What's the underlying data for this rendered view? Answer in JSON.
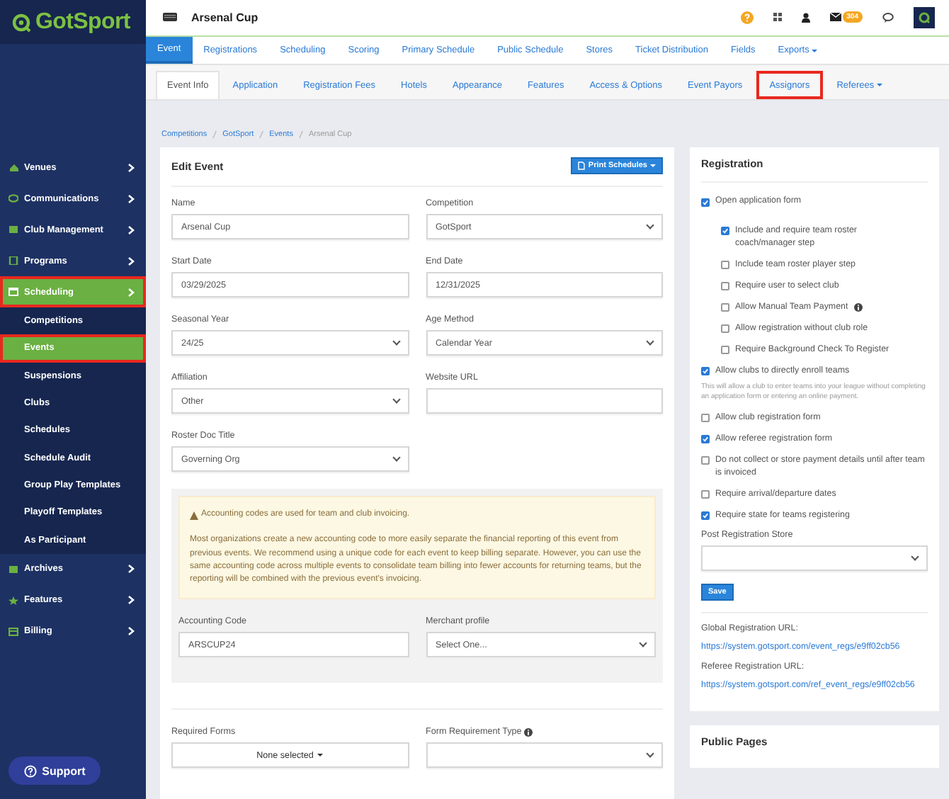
{
  "brand": {
    "name": "GotSport"
  },
  "sidebar": {
    "items": [
      {
        "label": "Venues",
        "selected": false,
        "highlighted": false
      },
      {
        "label": "Communications",
        "selected": false,
        "highlighted": false
      },
      {
        "label": "Club Management",
        "selected": false,
        "highlighted": false
      },
      {
        "label": "Programs",
        "selected": false,
        "highlighted": false
      },
      {
        "label": "Scheduling",
        "selected": true,
        "highlighted": true,
        "children": [
          {
            "label": "Competitions",
            "selected": false,
            "highlighted": false
          },
          {
            "label": "Events",
            "selected": true,
            "highlighted": true
          },
          {
            "label": "Suspensions",
            "selected": false,
            "highlighted": false
          },
          {
            "label": "Clubs",
            "selected": false,
            "highlighted": false
          },
          {
            "label": "Schedules",
            "selected": false,
            "highlighted": false
          },
          {
            "label": "Schedule Audit",
            "selected": false,
            "highlighted": false
          },
          {
            "label": "Group Play Templates",
            "selected": false,
            "highlighted": false
          },
          {
            "label": "Playoff Templates",
            "selected": false,
            "highlighted": false
          },
          {
            "label": "As Participant",
            "selected": false,
            "highlighted": false
          }
        ]
      },
      {
        "label": "Archives",
        "selected": false,
        "highlighted": false
      },
      {
        "label": "Features",
        "selected": false,
        "highlighted": false
      },
      {
        "label": "Billing",
        "selected": false,
        "highlighted": false
      }
    ]
  },
  "support": {
    "label": "Support"
  },
  "header": {
    "title": "Arsenal Cup",
    "badge": "304"
  },
  "nav": {
    "tabs": [
      {
        "label": "Event",
        "selected": true,
        "dropdown": false
      },
      {
        "label": "Registrations",
        "selected": false,
        "dropdown": false
      },
      {
        "label": "Scheduling",
        "selected": false,
        "dropdown": false
      },
      {
        "label": "Scoring",
        "selected": false,
        "dropdown": false
      },
      {
        "label": "Primary Schedule",
        "selected": false,
        "dropdown": false
      },
      {
        "label": "Public Schedule",
        "selected": false,
        "dropdown": false
      },
      {
        "label": "Stores",
        "selected": false,
        "dropdown": false
      },
      {
        "label": "Ticket Distribution",
        "selected": false,
        "dropdown": false
      },
      {
        "label": "Fields",
        "selected": false,
        "dropdown": false
      },
      {
        "label": "Exports",
        "selected": false,
        "dropdown": true
      }
    ]
  },
  "subnav": {
    "tabs": [
      {
        "label": "Event Info",
        "selected": true,
        "highlighted": false,
        "dropdown": false
      },
      {
        "label": "Application",
        "selected": false,
        "highlighted": false,
        "dropdown": false
      },
      {
        "label": "Registration Fees",
        "selected": false,
        "highlighted": false,
        "dropdown": false
      },
      {
        "label": "Hotels",
        "selected": false,
        "highlighted": false,
        "dropdown": false
      },
      {
        "label": "Appearance",
        "selected": false,
        "highlighted": false,
        "dropdown": false
      },
      {
        "label": "Features",
        "selected": false,
        "highlighted": false,
        "dropdown": false
      },
      {
        "label": "Access & Options",
        "selected": false,
        "highlighted": false,
        "dropdown": false
      },
      {
        "label": "Event Payors",
        "selected": false,
        "highlighted": false,
        "dropdown": false
      },
      {
        "label": "Assignors",
        "selected": false,
        "highlighted": true,
        "dropdown": false
      },
      {
        "label": "Referees",
        "selected": false,
        "highlighted": false,
        "dropdown": true
      }
    ]
  },
  "breadcrumb": [
    {
      "label": "Competitions",
      "link": true
    },
    {
      "label": "GotSport",
      "link": true
    },
    {
      "label": "Events",
      "link": true
    },
    {
      "label": "Arsenal Cup",
      "link": false
    }
  ],
  "edit_event": {
    "title": "Edit Event",
    "print_button": "Print Schedules",
    "fields": [
      {
        "label": "Name",
        "kind": "text",
        "value": "Arsenal Cup"
      },
      {
        "label": "Competition",
        "kind": "select",
        "value": "GotSport"
      },
      {
        "label": "Start Date",
        "kind": "text",
        "value": "03/29/2025"
      },
      {
        "label": "End Date",
        "kind": "text",
        "value": "12/31/2025"
      },
      {
        "label": "Seasonal Year",
        "kind": "select",
        "value": "24/25"
      },
      {
        "label": "Age Method",
        "kind": "select",
        "value": "Calendar Year"
      },
      {
        "label": "Affiliation",
        "kind": "select",
        "value": "Other"
      },
      {
        "label": "Website URL",
        "kind": "text"
      },
      {
        "label": "Roster Doc Title",
        "kind": "select",
        "value": "Governing Org"
      }
    ],
    "accounting": {
      "alert_title": "Accounting codes are used for team and club invoicing.",
      "alert_body": "Most organizations create a new accounting code to more easily separate the financial reporting of this event from previous events. We recommend using a unique code for each event to keep billing separate. However, you can use the same accounting code across multiple events to consolidate team billing into fewer accounts for returning teams, but the reporting will be combined with the previous event's invoicing.",
      "fields": [
        {
          "label": "Accounting Code",
          "kind": "text",
          "value": "ARSCUP24"
        },
        {
          "label": "Merchant profile",
          "kind": "select",
          "value": "Select One..."
        }
      ]
    },
    "form_fields": [
      {
        "label": "Required Forms",
        "kind": "multiselect",
        "value": "None selected"
      },
      {
        "label": "Form Requirement Type",
        "kind": "select",
        "info": true
      }
    ]
  },
  "registration": {
    "title": "Registration",
    "options": [
      {
        "label": "Open application form",
        "checked": true,
        "children": [
          {
            "label": "Include and require team roster coach/manager step",
            "checked": true
          },
          {
            "label": "Include team roster player step",
            "checked": false
          },
          {
            "label": "Require user to select club",
            "checked": false
          },
          {
            "label": "Allow Manual Team Payment",
            "checked": false,
            "info": true
          },
          {
            "label": "Allow registration without club role",
            "checked": false
          },
          {
            "label": "Require Background Check To Register",
            "checked": false
          }
        ]
      },
      {
        "label": "Allow clubs to directly enroll teams",
        "checked": true,
        "note": "This will allow a club to enter teams into your league without completing an application form or entering an online payment."
      },
      {
        "label": "Allow club registration form",
        "checked": false
      },
      {
        "label": "Allow referee registration form",
        "checked": true
      },
      {
        "label": "Do not collect or store payment details until after team is invoiced",
        "checked": false
      },
      {
        "label": "Require arrival/departure dates",
        "checked": false
      },
      {
        "label": "Require state for teams registering",
        "checked": true
      }
    ],
    "store": {
      "label": "Post Registration Store"
    },
    "save": "Save",
    "urls": [
      {
        "label": "Global Registration URL:",
        "url": "https://system.gotsport.com/event_regs/e9ff02cb56"
      },
      {
        "label": "Referee Registration URL:",
        "url": "https://system.gotsport.com/ref_event_regs/e9ff02cb56"
      }
    ]
  },
  "public_pages": {
    "title": "Public Pages"
  }
}
